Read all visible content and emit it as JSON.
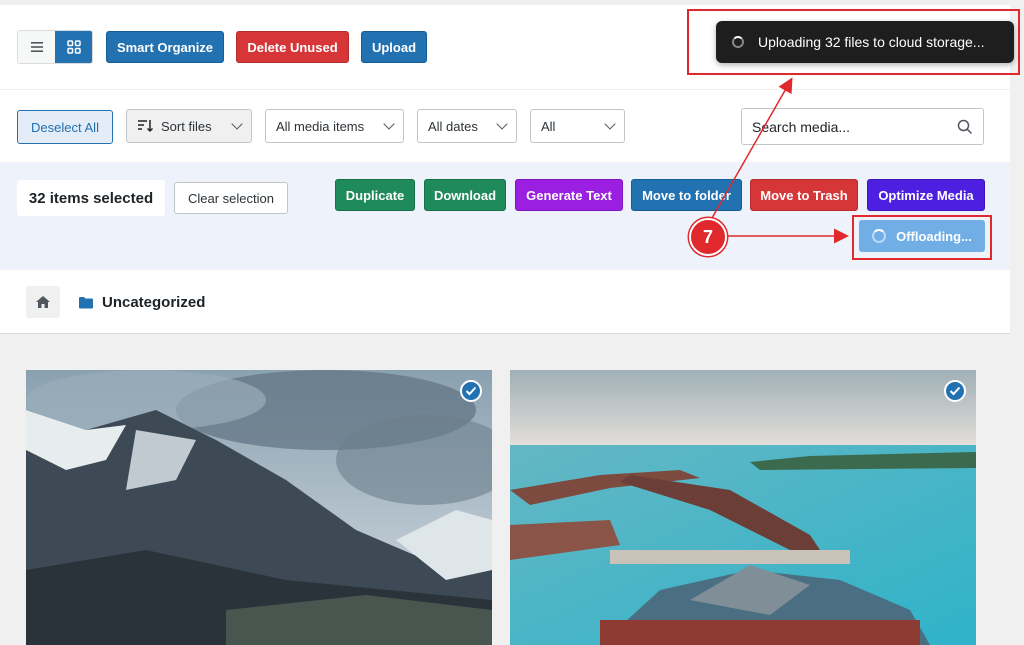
{
  "toolbar": {
    "smart_organize": "Smart Organize",
    "delete_unused": "Delete Unused",
    "upload": "Upload"
  },
  "toast": {
    "message": "Uploading 32 files to cloud storage..."
  },
  "filters": {
    "deselect_all": "Deselect All",
    "sort_files": "Sort files",
    "media_type": "All media items",
    "dates": "All dates",
    "all": "All",
    "search_placeholder": "Search media..."
  },
  "selection": {
    "count_label": "32 items selected",
    "clear_label": "Clear selection",
    "actions": {
      "duplicate": "Duplicate",
      "download": "Download",
      "generate_text": "Generate Text",
      "move_to_folder": "Move to folder",
      "move_to_trash": "Move to Trash",
      "optimize_media": "Optimize Media",
      "offloading": "Offloading..."
    }
  },
  "annotation": {
    "step": "7"
  },
  "breadcrumb": {
    "folder": "Uncategorized"
  },
  "colors": {
    "primary": "#2271b1",
    "danger": "#d63638",
    "success": "#1f8a5b",
    "purple": "#9b1fe0",
    "indigo": "#4d1fe0",
    "annotation_red": "#e0292c"
  }
}
